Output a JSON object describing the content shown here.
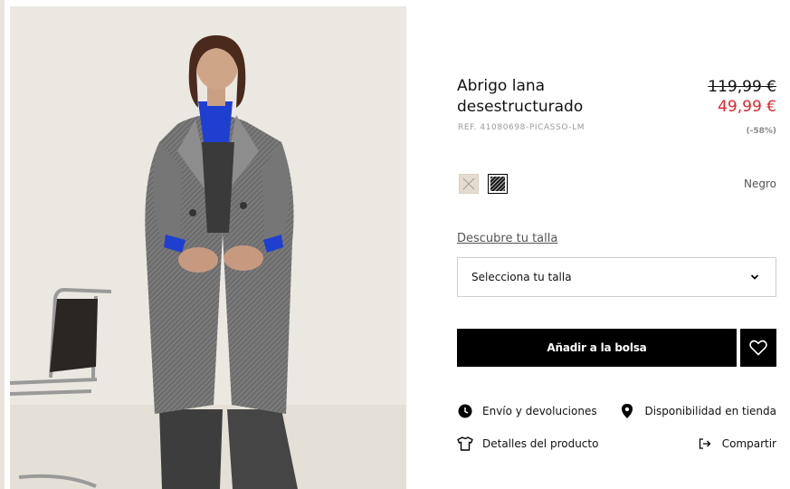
{
  "product": {
    "title": "Abrigo lana desestructurado",
    "reference": "REF. 41080698-PICASSO-LM",
    "price_original": "119,99 €",
    "price_sale": "49,99 €",
    "discount": "(-58%)"
  },
  "colors": {
    "options": [
      "beige",
      "negro"
    ],
    "selected_name": "Negro"
  },
  "size": {
    "guide_link": "Descubre tu talla",
    "select_placeholder": "Selecciona tu talla"
  },
  "actions": {
    "add_to_bag": "Añadir a la bolsa"
  },
  "links": {
    "shipping": "Envío y devoluciones",
    "store_availability": "Disponibilidad en tienda",
    "product_details": "Detalles del producto",
    "share": "Compartir"
  },
  "icons": {
    "shipping": "clock-icon",
    "store": "location-pin-icon",
    "details": "tshirt-icon",
    "share": "share-icon",
    "wishlist": "heart-icon",
    "dropdown": "chevron-down-icon"
  },
  "colors_hex": {
    "sale_price": "#e0242c",
    "button": "#000000",
    "photo_background": "#ebe8e1"
  }
}
